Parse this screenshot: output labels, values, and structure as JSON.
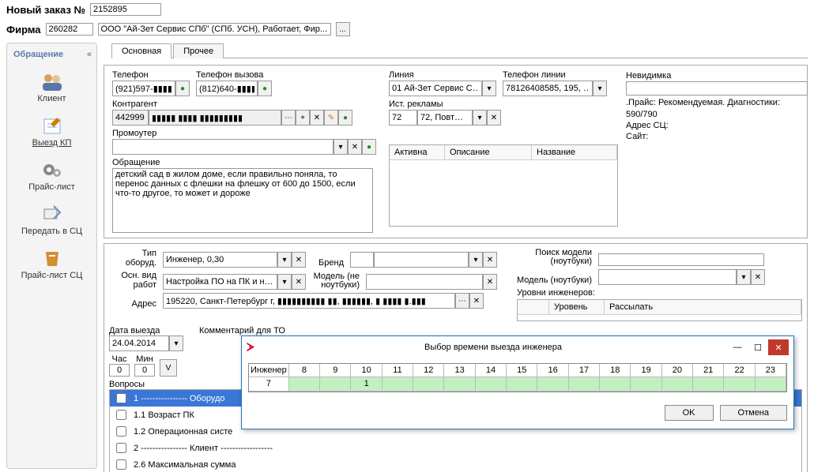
{
  "header": {
    "order_label": "Новый заказ №",
    "order_no": "2152895",
    "firm_label": "Фирма",
    "firm_code": "260282",
    "firm_name": "ООО \"Ай-Зет Сервис СПб\" (СПб. УСН), Работает, Фир...",
    "firm_more": "..."
  },
  "sidebar": {
    "title": "Обращение",
    "collapse": "«",
    "items": [
      {
        "label": "Клиент"
      },
      {
        "label": "Выезд КП"
      },
      {
        "label": "Прайс-лист"
      },
      {
        "label": "Передать в СЦ"
      },
      {
        "label": "Прайс-лист СЦ"
      }
    ]
  },
  "tabs": {
    "main": "Основная",
    "other": "Прочее"
  },
  "form": {
    "phone_label": "Телефон",
    "phone": "(921)597-▮▮▮▮",
    "call_phone_label": "Телефон вызова",
    "call_phone": "(812)640-▮▮▮▮",
    "line_label": "Линия",
    "line": "01 Ай-Зет Сервис С…",
    "line_phone_label": "Телефон линии",
    "line_phone": "78126408585, 195, …",
    "contragent_label": "Контрагент",
    "contragent_code": "442999",
    "contragent_name": "▮▮▮▮▮ ▮▮▮▮ ▮▮▮▮▮▮▮▮▮",
    "adsource_label": "Ист. рекламы",
    "adsource_code": "72",
    "adsource_name": "72, Повт…",
    "promoter_label": "Промоутер",
    "promoter": "",
    "request_label": "Обращение",
    "request_text": "детский сад в жилом доме, если правильно поняла, то перенос данных с флешки на флешку от 600 до 1500, если что-то другое, то может и дороже",
    "invisible_label": "Невидимка",
    "info_price": ".Прайс: Рекомендуемая. Диагностики: 590/790",
    "info_addr": "Адрес СЦ:",
    "info_site": "Сайт:",
    "cols": {
      "active": "Активна",
      "desc": "Описание",
      "name": "Название"
    }
  },
  "lower": {
    "equip_label": "Тип оборуд.",
    "equip": "Инженер, 0,30",
    "work_label": "Осн. вид работ",
    "work": "Настройка ПО на ПК и н…",
    "brand_label": "Бренд",
    "brand": "",
    "model_nl_label": "Модель (не ноутбуки)",
    "model_nl": "",
    "model_search_label": "Поиск модели (ноутбуки)",
    "model_laptop_label": "Модель (ноутбуки)",
    "addr_label": "Адрес",
    "addr": "195220, Санкт-Петербург г, ▮▮▮▮▮▮▮▮▮▮ ▮▮, ▮▮▮▮▮▮, ▮ ▮▮▮▮ ▮.▮▮▮",
    "levels_label": "Уровни инженеров:",
    "level_col": "Уровень",
    "send_col": "Рассылать",
    "date_label": "Дата выезда",
    "date": "24.04.2014",
    "hour": "Час",
    "min": "Мин",
    "hour_v": "0",
    "min_v": "0",
    "vbtn": "V",
    "comment_label": "Комментарий для ТО",
    "questions_label": "Вопросы",
    "questions": [
      "1 ---------------- Оборудо",
      "1.1 Возраст ПК",
      "1.2 Операционная систе",
      "2 ---------------- Клиент ------------------",
      "2.6 Максимальная сумма"
    ]
  },
  "dialog": {
    "title": "Выбор времени выезда инженера",
    "eng_label": "Инженер",
    "hours": [
      "8",
      "9",
      "10",
      "11",
      "12",
      "13",
      "14",
      "15",
      "16",
      "17",
      "18",
      "19",
      "20",
      "21",
      "22",
      "23"
    ],
    "row_label": "7",
    "row_values": [
      "",
      "",
      "1",
      "",
      "",
      "",
      "",
      "",
      "",
      "",
      "",
      "",
      "",
      "",
      "",
      ""
    ],
    "ok": "OK",
    "cancel": "Отмена"
  },
  "icons": {
    "ellipsis": "⋯",
    "plus": "+",
    "x": "✕",
    "down": "▾",
    "phone": "●",
    "pencil": "✎"
  }
}
